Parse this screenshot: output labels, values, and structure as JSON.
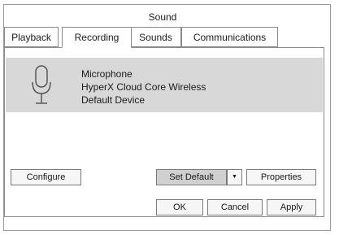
{
  "window": {
    "title": "Sound"
  },
  "tabs": [
    {
      "label": "Playback"
    },
    {
      "label": "Recording"
    },
    {
      "label": "Sounds"
    },
    {
      "label": "Communications"
    }
  ],
  "active_tab": "Recording",
  "device": {
    "icon": "microphone-icon",
    "name": "Microphone",
    "description": "HyperX Cloud Core Wireless",
    "status": "Default Device"
  },
  "buttons": {
    "configure": "Configure",
    "set_default": "Set Default",
    "set_default_arrow": "▼",
    "properties": "Properties",
    "ok": "OK",
    "cancel": "Cancel",
    "apply": "Apply"
  }
}
